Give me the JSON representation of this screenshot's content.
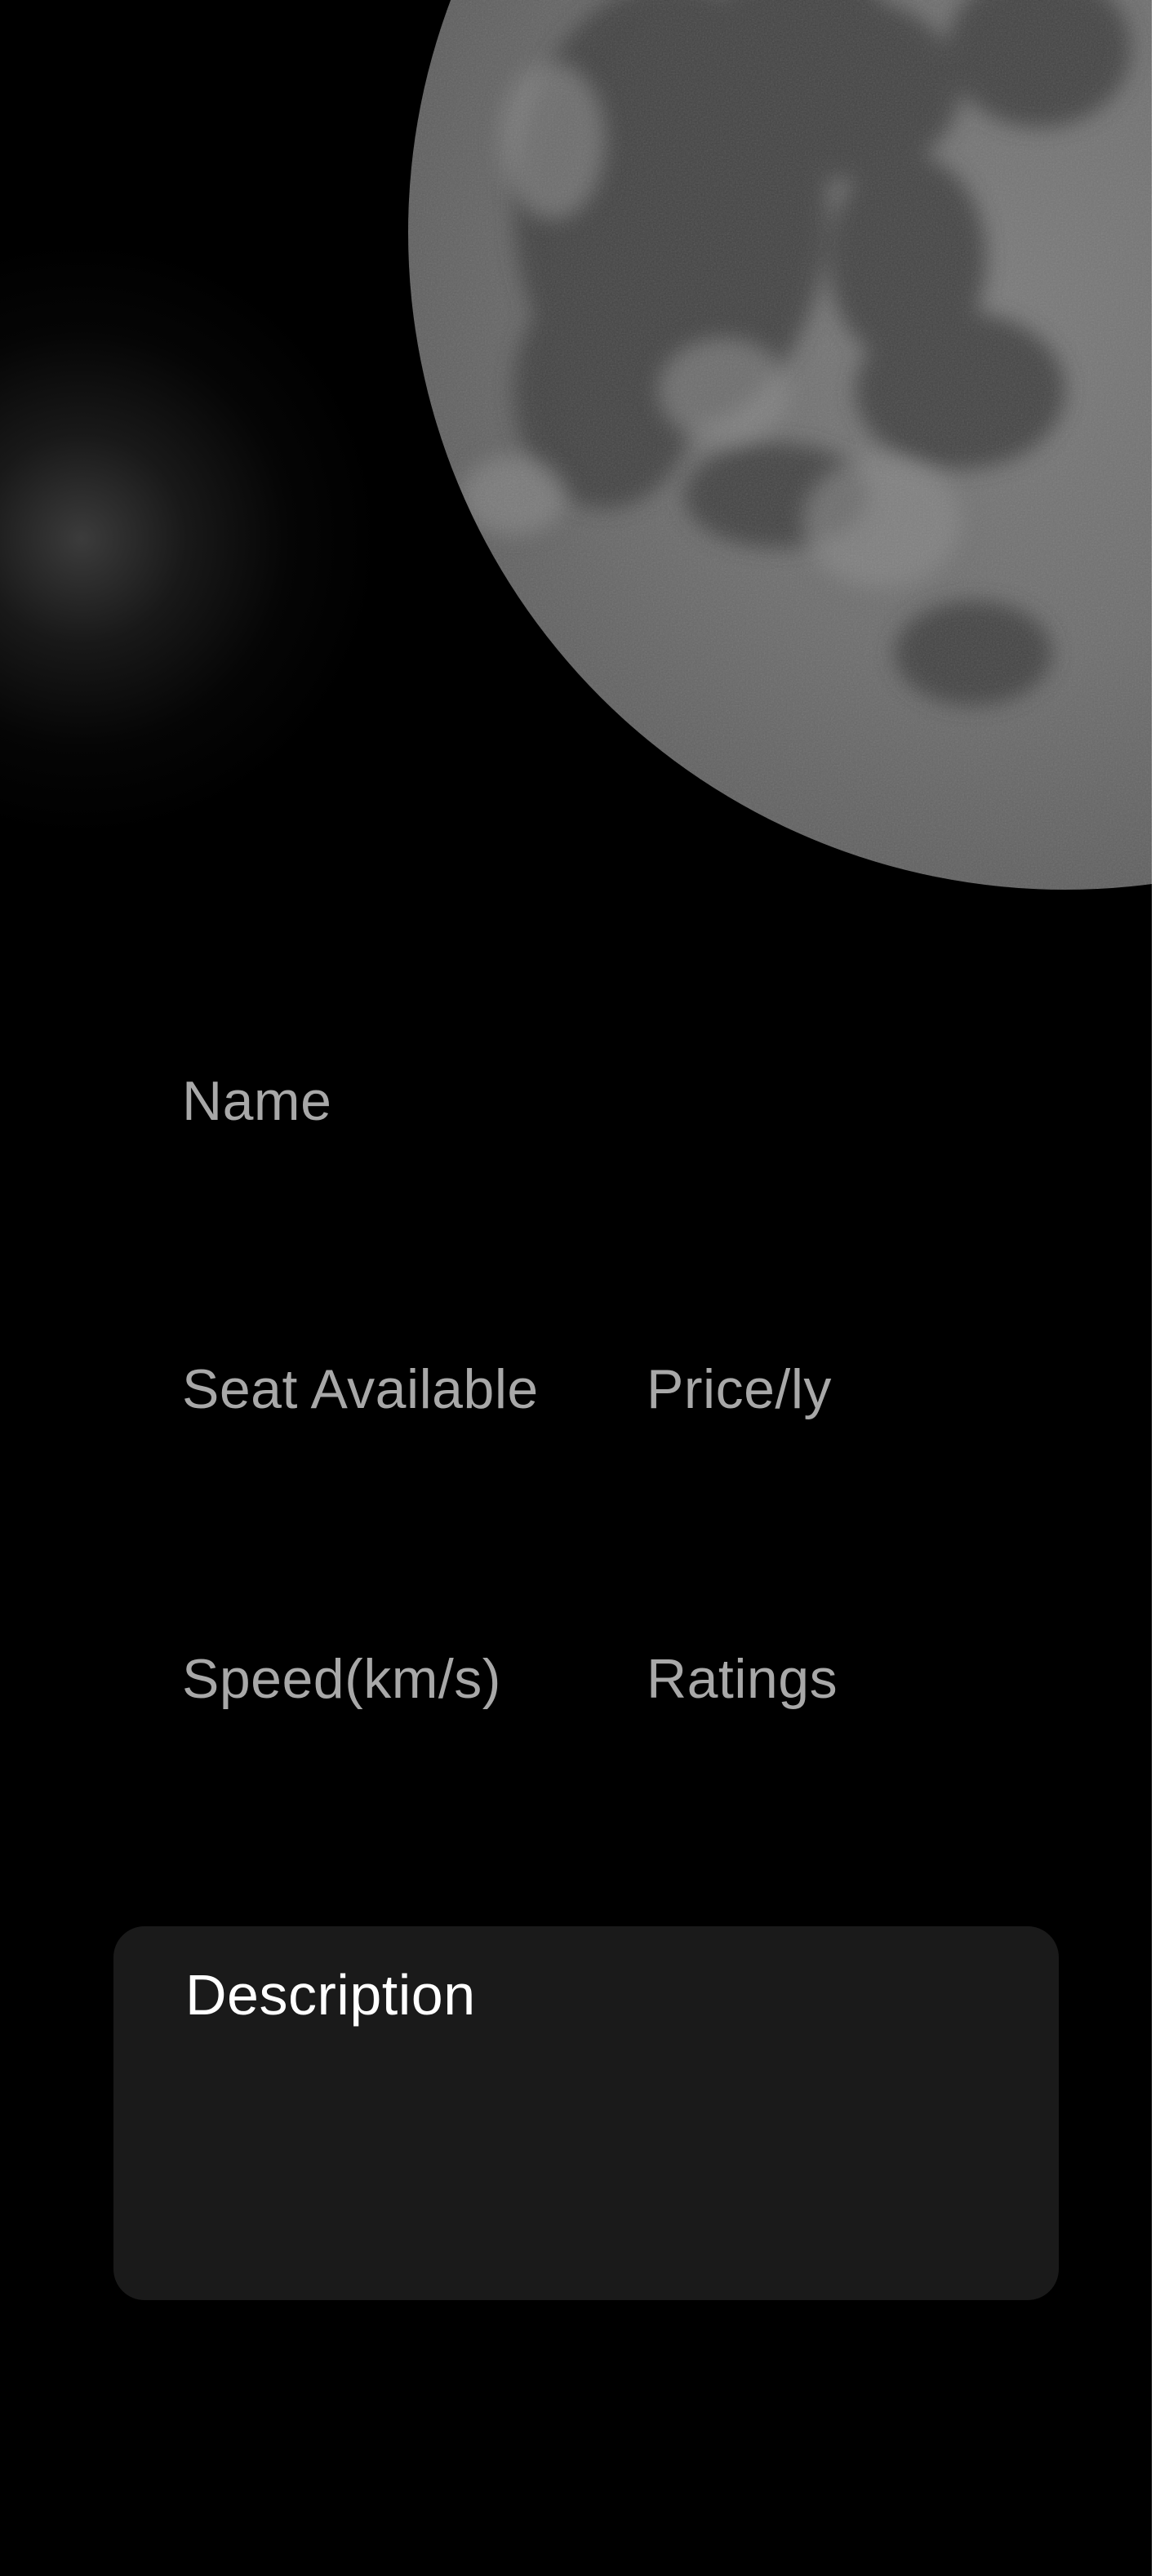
{
  "hero": {
    "image": "moon-image",
    "background_color": "#000000"
  },
  "form": {
    "name_label": "Name",
    "seat_available_label": "Seat Available",
    "price_label": "Price/ly",
    "speed_label": "Speed(km/s)",
    "ratings_label": "Ratings",
    "description_label": "Description"
  },
  "colors": {
    "label_gray": "#a8a8a8",
    "card_background": "#1a1a1a",
    "description_text": "#ffffff"
  }
}
